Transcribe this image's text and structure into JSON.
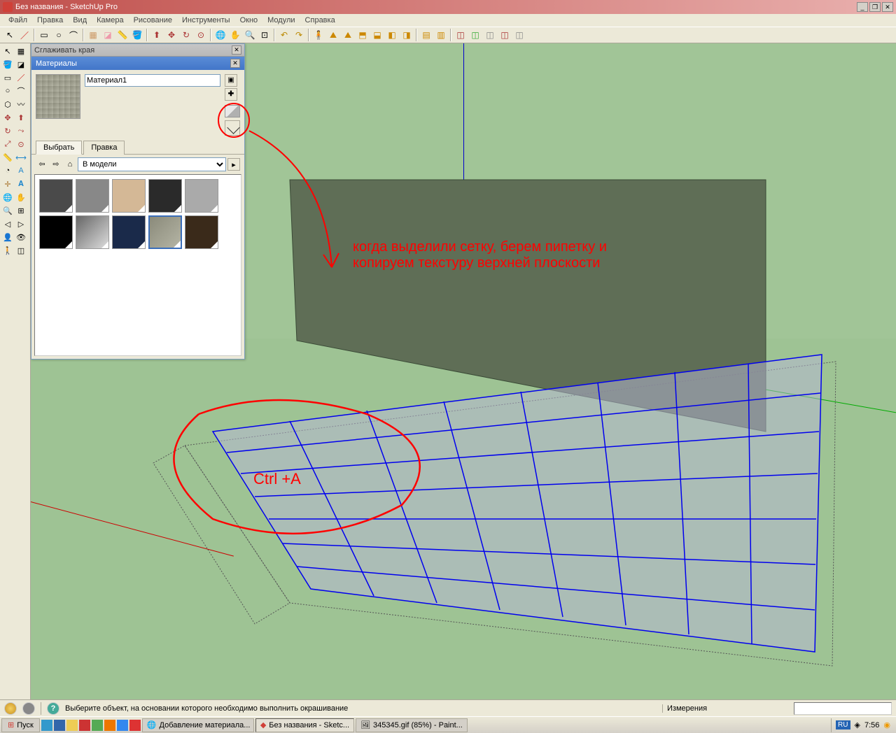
{
  "window": {
    "title": "Без названия - SketchUp Pro"
  },
  "menu": {
    "file": "Файл",
    "edit": "Правка",
    "view": "Вид",
    "camera": "Камера",
    "draw": "Рисование",
    "tools": "Инструменты",
    "window": "Окно",
    "plugins": "Модули",
    "help": "Справка"
  },
  "smooth_panel": {
    "title": "Сглаживать края"
  },
  "materials": {
    "title": "Материалы",
    "name": "Материал1",
    "tab_select": "Выбрать",
    "tab_edit": "Правка",
    "location": "В модели"
  },
  "annotations": {
    "main_line1": "когда выделили сетку, берем пипетку и",
    "main_line2": "копируем текстуру верхней плоскости",
    "shortcut": "Ctrl +A"
  },
  "status": {
    "hint": "Выберите объект, на основании которого необходимо выполнить окрашивание",
    "measure_label": "Измерения"
  },
  "taskbar": {
    "start": "Пуск",
    "task1": "Добавление материала...",
    "task2": "Без названия - Sketc...",
    "task3": "345345.gif (85%) - Paint...",
    "lang": "RU",
    "time": "7:56"
  }
}
